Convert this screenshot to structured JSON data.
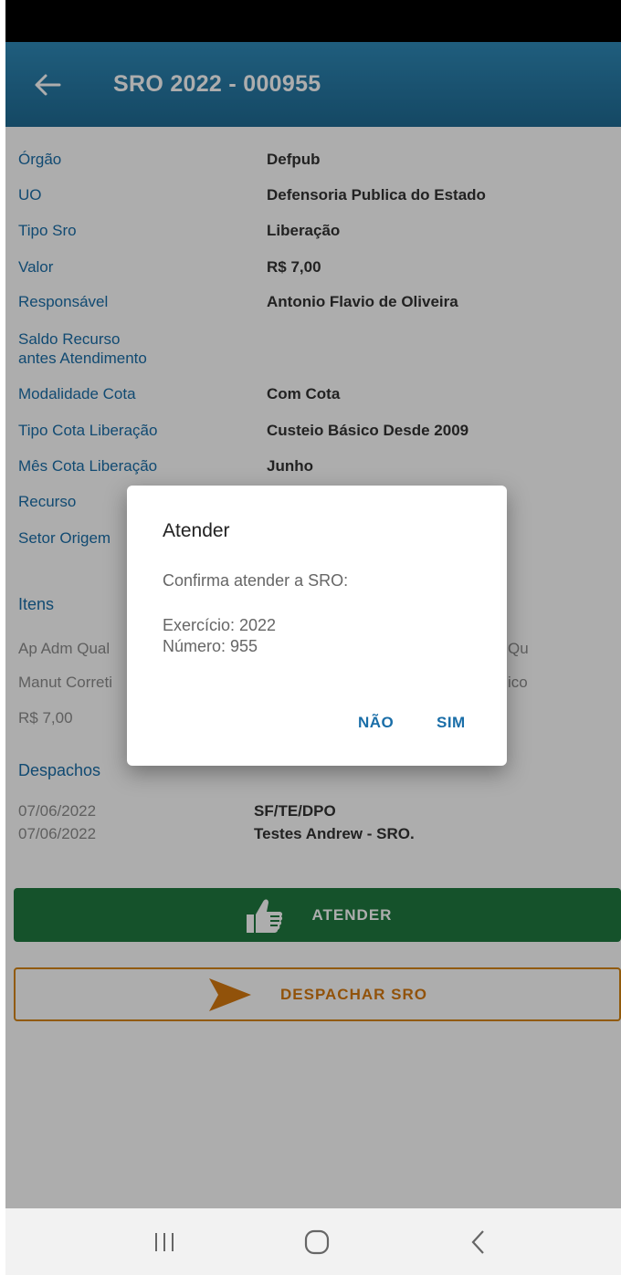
{
  "header": {
    "title": "SRO 2022 - 000955",
    "back_icon": "arrow-left-icon"
  },
  "details": [
    {
      "label": "Órgão",
      "value": "Defpub"
    },
    {
      "label": "UO",
      "value": "Defensoria Publica do Estado"
    },
    {
      "label": "Tipo Sro",
      "value": "Liberação"
    },
    {
      "label": "Valor",
      "value": "R$ 7,00"
    },
    {
      "label": "Responsável",
      "value": "Antonio Flavio de Oliveira"
    },
    {
      "label": "Saldo Recurso\nantes Atendimento",
      "value": ""
    },
    {
      "label": "Modalidade Cota",
      "value": "Com Cota"
    },
    {
      "label": "Tipo Cota Liberação",
      "value": "Custeio Básico Desde 2009"
    },
    {
      "label": "Mês Cota Liberação",
      "value": "Junho"
    },
    {
      "label": "Recurso",
      "value": ""
    },
    {
      "label": "Setor Origem",
      "value": ""
    }
  ],
  "itens": {
    "title": "Itens",
    "rows": [
      {
        "left": "Ap Adm Qual",
        "right": "Qu"
      },
      {
        "left": "Manut Correti",
        "right": "ico"
      },
      {
        "left": "R$ 7,00",
        "right": ""
      }
    ]
  },
  "despachos": {
    "title": "Despachos",
    "rows": [
      {
        "date": "07/06/2022",
        "value": "SF/TE/DPO"
      },
      {
        "date": "07/06/2022",
        "value": "Testes Andrew - SRO."
      }
    ]
  },
  "actions": {
    "atender_label": "ATENDER",
    "atender_icon": "thumbs-up-icon",
    "despachar_label": "DESPACHAR SRO",
    "despachar_icon": "send-arrow-icon"
  },
  "dialog": {
    "title": "Atender",
    "message": "Confirma atender a SRO:",
    "exercicio": "Exercício: 2022",
    "numero": "Número: 955",
    "no_label": "NÃO",
    "yes_label": "SIM"
  },
  "colors": {
    "appbar": "#2a80ad",
    "link_blue": "#1a6ea8",
    "atender_green": "#1f7a40",
    "despachar_orange": "#d68512"
  }
}
